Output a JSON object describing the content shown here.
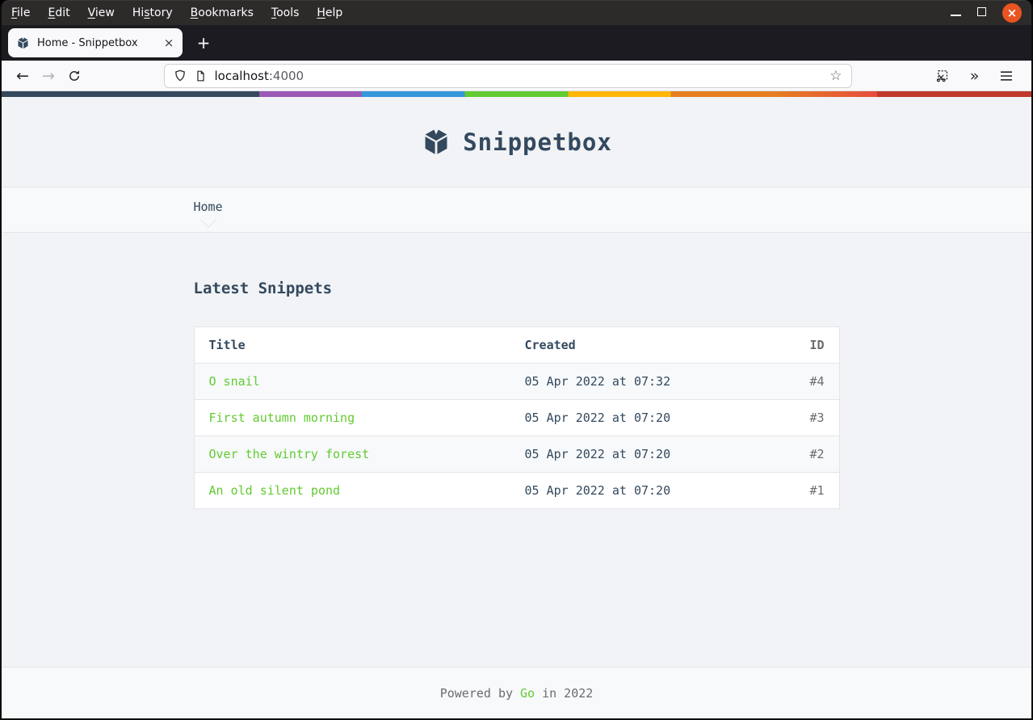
{
  "window": {
    "menubar": {
      "items": [
        {
          "label": "File",
          "accel": 0
        },
        {
          "label": "Edit",
          "accel": 0
        },
        {
          "label": "View",
          "accel": 0
        },
        {
          "label": "History",
          "accel": 2
        },
        {
          "label": "Bookmarks",
          "accel": 0
        },
        {
          "label": "Tools",
          "accel": 0
        },
        {
          "label": "Help",
          "accel": 0
        }
      ],
      "controls": {
        "minimize_icon": "minimize-icon",
        "maximize_icon": "maximize-icon",
        "close_glyph": "×"
      }
    },
    "tabbar": {
      "tab_title": "Home - Snippetbox",
      "tab_close_glyph": "×",
      "new_tab_glyph": "+"
    },
    "toolbar": {
      "back_glyph": "←",
      "forward_glyph": "→",
      "url_host": "localhost",
      "url_port": ":4000",
      "star_glyph": "☆",
      "overflow_glyph": "»"
    }
  },
  "page": {
    "header": {
      "site_title": "Snippetbox"
    },
    "nav": {
      "home_label": "Home"
    },
    "main": {
      "heading": "Latest Snippets",
      "table": {
        "headers": [
          "Title",
          "Created",
          "ID"
        ],
        "rows": [
          {
            "title": "O snail",
            "created": "05 Apr 2022 at 07:32",
            "id": "#4"
          },
          {
            "title": "First autumn morning",
            "created": "05 Apr 2022 at 07:20",
            "id": "#3"
          },
          {
            "title": "Over the wintry forest",
            "created": "05 Apr 2022 at 07:20",
            "id": "#2"
          },
          {
            "title": "An old silent pond",
            "created": "05 Apr 2022 at 07:20",
            "id": "#1"
          }
        ]
      }
    },
    "footer": {
      "prefix": "Powered by",
      "link_label": "Go",
      "suffix": "in 2022"
    }
  },
  "colors": {
    "brand_navy": "#34495e",
    "link_green": "#62cb31",
    "muted_text": "#6a6c6f",
    "border": "#e4e5e7",
    "page_bg": "#f1f3f6",
    "panel_bg": "#f7f9fa",
    "ubuntu_orange": "#e95420",
    "stripe_stops": [
      "#34495e",
      "#9b59b6",
      "#3498db",
      "#62cb31",
      "#ffb606",
      "#e67e22",
      "#e74c3c",
      "#c0392b"
    ]
  }
}
